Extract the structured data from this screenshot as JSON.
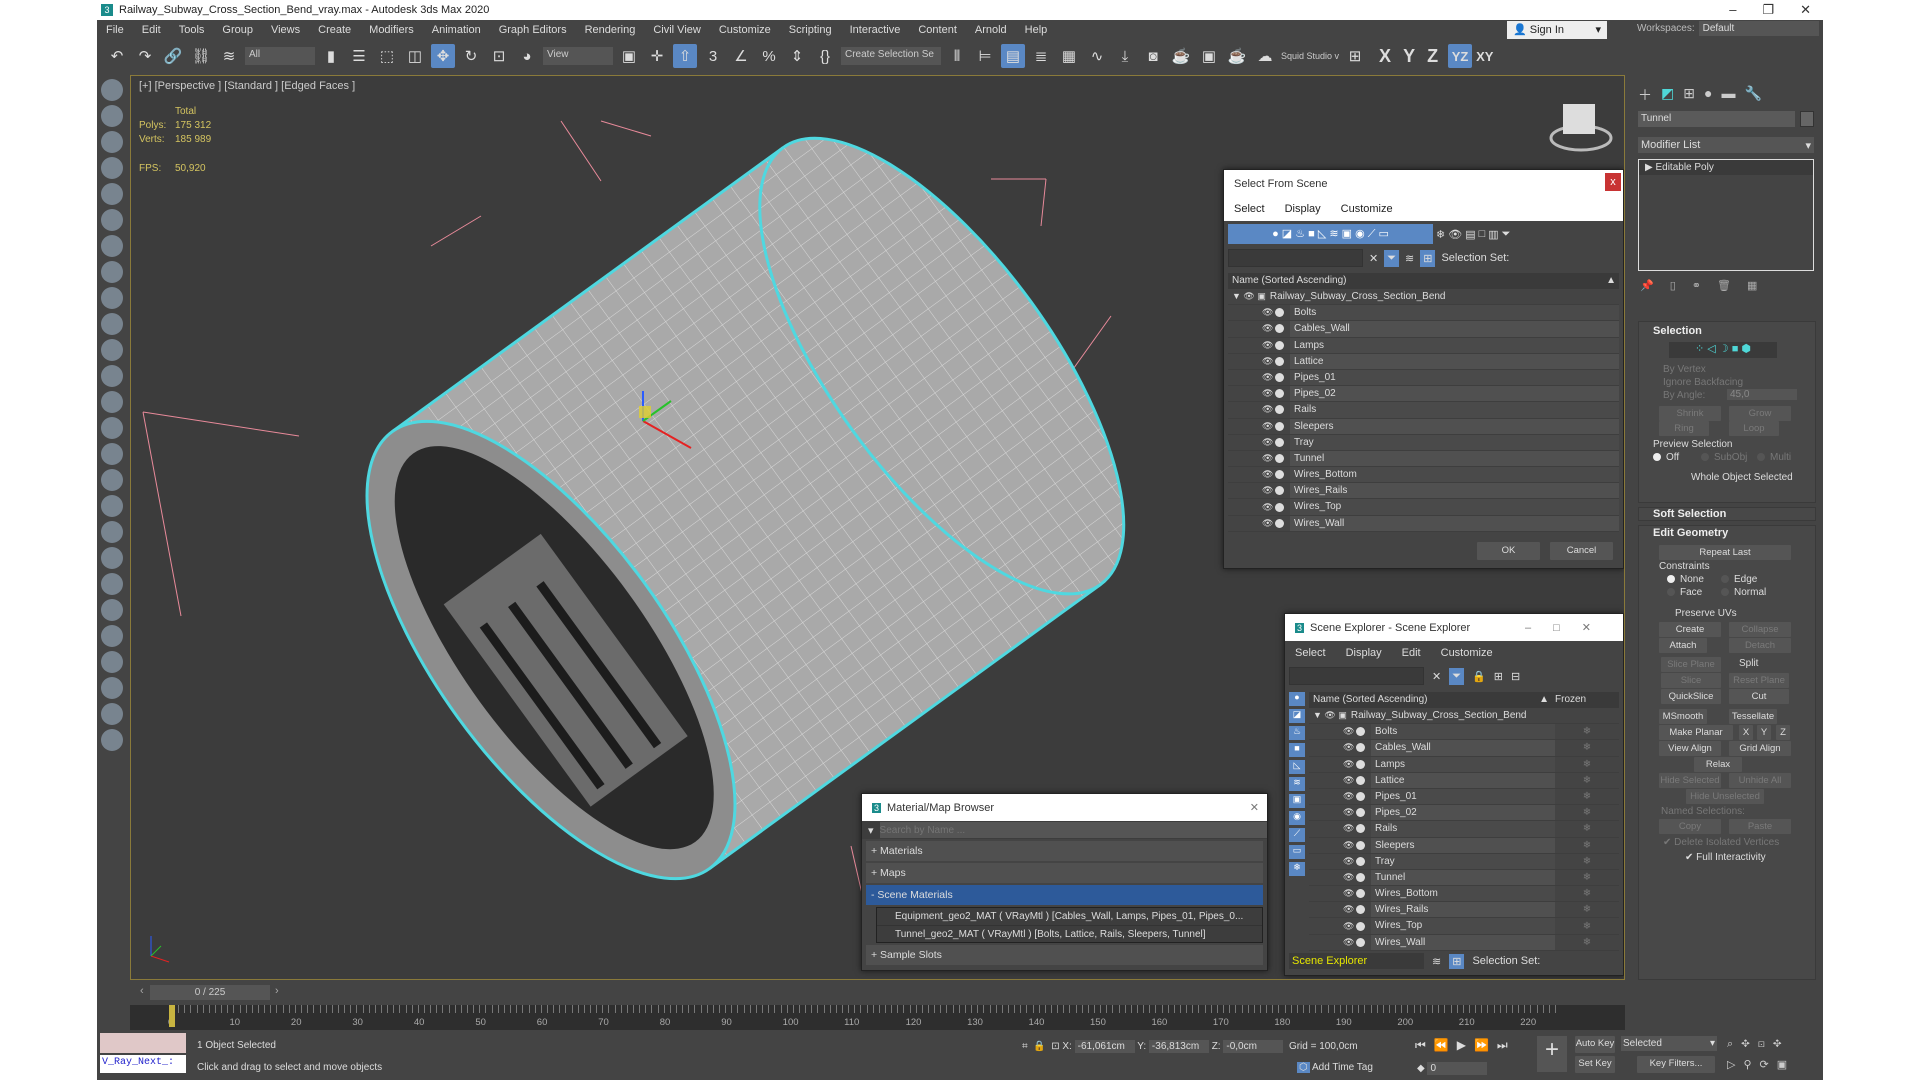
{
  "window": {
    "title": "Railway_Subway_Cross_Section_Bend_vray.max - Autodesk 3ds Max 2020",
    "logo": "3"
  },
  "menu": [
    "File",
    "Edit",
    "Tools",
    "Group",
    "Views",
    "Create",
    "Modifiers",
    "Animation",
    "Graph Editors",
    "Rendering",
    "Civil View",
    "Customize",
    "Scripting",
    "Interactive",
    "Content",
    "Arnold",
    "Help"
  ],
  "signin": "Sign In",
  "workspaces_label": "Workspaces:",
  "workspace": "Default",
  "toolbar": {
    "filter": "All",
    "ref_coord": "View",
    "selection_set": "Create Selection Se",
    "squid": "Squid Studio v",
    "axes": [
      "X",
      "Y",
      "Z",
      "YZ",
      "XY"
    ]
  },
  "viewport": {
    "label": "[+] [Perspective ] [Standard ] [Edged Faces ]",
    "stats": {
      "total": "Total",
      "polys_label": "Polys:",
      "polys": "175 312",
      "verts_label": "Verts:",
      "verts": "185 989",
      "fps_label": "FPS:",
      "fps": "50,920"
    }
  },
  "panel": {
    "object_name": "Tunnel",
    "modifier_list": "Modifier List",
    "stack": [
      "Editable Poly"
    ],
    "selection": {
      "title": "Selection",
      "by_vertex": "By Vertex",
      "ignore_backfacing": "Ignore Backfacing",
      "by_angle": "By Angle:",
      "angle": "45,0",
      "shrink": "Shrink",
      "grow": "Grow",
      "ring": "Ring",
      "loop": "Loop",
      "preview": "Preview Selection",
      "off": "Off",
      "subobj": "SubObj",
      "multi": "Multi",
      "status": "Whole Object Selected"
    },
    "soft_selection": "Soft Selection",
    "edit_geometry": {
      "title": "Edit Geometry",
      "repeat_last": "Repeat Last",
      "constraints": "Constraints",
      "none": "None",
      "edge": "Edge",
      "face": "Face",
      "normal": "Normal",
      "preserve_uvs": "Preserve UVs",
      "create": "Create",
      "collapse": "Collapse",
      "attach": "Attach",
      "detach": "Detach",
      "slice_plane": "Slice Plane",
      "split": "Split",
      "slice": "Slice",
      "reset_plane": "Reset Plane",
      "quickslice": "QuickSlice",
      "cut": "Cut",
      "msmooth": "MSmooth",
      "tessellate": "Tessellate",
      "make_planar": "Make Planar",
      "x": "X",
      "y": "Y",
      "z": "Z",
      "view_align": "View Align",
      "grid_align": "Grid Align",
      "relax": "Relax",
      "hide_selected": "Hide Selected",
      "unhide_all": "Unhide All",
      "hide_unselected": "Hide Unselected",
      "named_selections": "Named Selections:",
      "copy": "Copy",
      "paste": "Paste",
      "delete_isolated": "Delete Isolated Vertices",
      "full_interactivity": "Full Interactivity"
    }
  },
  "select_from_scene": {
    "title": "Select From Scene",
    "close": "x",
    "menu": [
      "Select",
      "Display",
      "Customize"
    ],
    "selection_set": "Selection Set:",
    "column": "Name (Sorted Ascending)",
    "root": "Railway_Subway_Cross_Section_Bend",
    "items": [
      "Bolts",
      "Cables_Wall",
      "Lamps",
      "Lattice",
      "Pipes_01",
      "Pipes_02",
      "Rails",
      "Sleepers",
      "Tray",
      "Tunnel",
      "Wires_Bottom",
      "Wires_Rails",
      "Wires_Top",
      "Wires_Wall"
    ],
    "ok": "OK",
    "cancel": "Cancel"
  },
  "scene_explorer": {
    "title": "Scene Explorer - Scene Explorer",
    "menu": [
      "Select",
      "Display",
      "Edit",
      "Customize"
    ],
    "column": "Name (Sorted Ascending)",
    "frozen": "Frozen",
    "root": "Railway_Subway_Cross_Section_Bend",
    "items": [
      "Bolts",
      "Cables_Wall",
      "Lamps",
      "Lattice",
      "Pipes_01",
      "Pipes_02",
      "Rails",
      "Sleepers",
      "Tray",
      "Tunnel",
      "Wires_Bottom",
      "Wires_Rails",
      "Wires_Top",
      "Wires_Wall"
    ],
    "explorer_name": "Scene Explorer",
    "selection_set": "Selection Set:"
  },
  "material_browser": {
    "title": "Material/Map Browser",
    "search_placeholder": "Search by Name ...",
    "materials": "+ Materials",
    "maps": "+ Maps",
    "scene_materials": "- Scene Materials",
    "scene_items": [
      "Equipment_geo2_MAT  ( VRayMtl ) [Cables_Wall, Lamps, Pipes_01, Pipes_0...",
      "Tunnel_geo2_MAT  ( VRayMtl ) [Bolts, Lattice, Rails, Sleepers, Tunnel]"
    ],
    "sample_slots": "+ Sample Slots"
  },
  "timeline": {
    "frame": "0 / 225",
    "labels": [
      "0",
      "10",
      "20",
      "30",
      "40",
      "50",
      "60",
      "70",
      "80",
      "90",
      "100",
      "110",
      "120",
      "130",
      "140",
      "150",
      "160",
      "170",
      "180",
      "190",
      "200",
      "210",
      "220"
    ]
  },
  "status": {
    "selected": "1 Object Selected",
    "hint": "Click and drag to select and move objects",
    "script": "V_Ray_Next_:",
    "x_label": "X:",
    "x": "-61,061cm",
    "y_label": "Y:",
    "y": "-36,813cm",
    "z_label": "Z:",
    "z": "-0,0cm",
    "grid": "Grid = 100,0cm",
    "add_time_tag": "Add Time Tag",
    "frame": "0",
    "auto_key": "Auto Key",
    "set_key": "Set Key",
    "key_mode": "Selected",
    "key_filters": "Key Filters..."
  },
  "colors": {
    "accent": "#5a88c4",
    "selection_outline": "#4fd8e0",
    "stats": "#d4c460"
  }
}
